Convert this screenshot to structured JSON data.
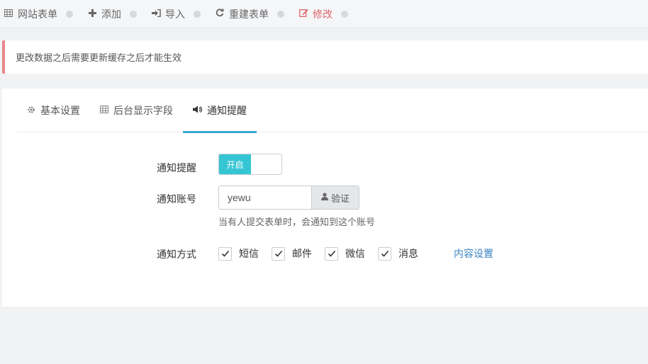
{
  "toolbar": {
    "items": [
      {
        "label": "网站表单",
        "icon": "table-icon"
      },
      {
        "label": "添加",
        "icon": "plus-icon"
      },
      {
        "label": "导入",
        "icon": "sign-in-icon"
      },
      {
        "label": "重建表单",
        "icon": "refresh-icon"
      },
      {
        "label": "修改",
        "icon": "edit-icon",
        "active": true
      }
    ],
    "active_color": "#e0656a"
  },
  "notice": {
    "text": "更改数据之后需要更新缓存之后才能生效",
    "border_color": "#e7868a"
  },
  "tabs": [
    {
      "label": "基本设置",
      "icon": "gear-icon"
    },
    {
      "label": "后台显示字段",
      "icon": "table-icon"
    },
    {
      "label": "通知提醒",
      "icon": "volume-icon",
      "active": true
    }
  ],
  "form": {
    "notify": {
      "label": "通知提醒",
      "switch_text": "开启",
      "switch_on": true
    },
    "account": {
      "label": "通知账号",
      "value": "yewu",
      "verify_label": "验证",
      "help": "当有人提交表单时，会通知到这个账号"
    },
    "method": {
      "label": "通知方式",
      "options": [
        {
          "label": "短信",
          "checked": true
        },
        {
          "label": "邮件",
          "checked": true
        },
        {
          "label": "微信",
          "checked": true
        },
        {
          "label": "消息",
          "checked": true
        }
      ],
      "content_link": "内容设置"
    }
  },
  "colors": {
    "accent": "#36a9d9",
    "switch_on": "#36c6d3",
    "link": "#3b84c1"
  }
}
